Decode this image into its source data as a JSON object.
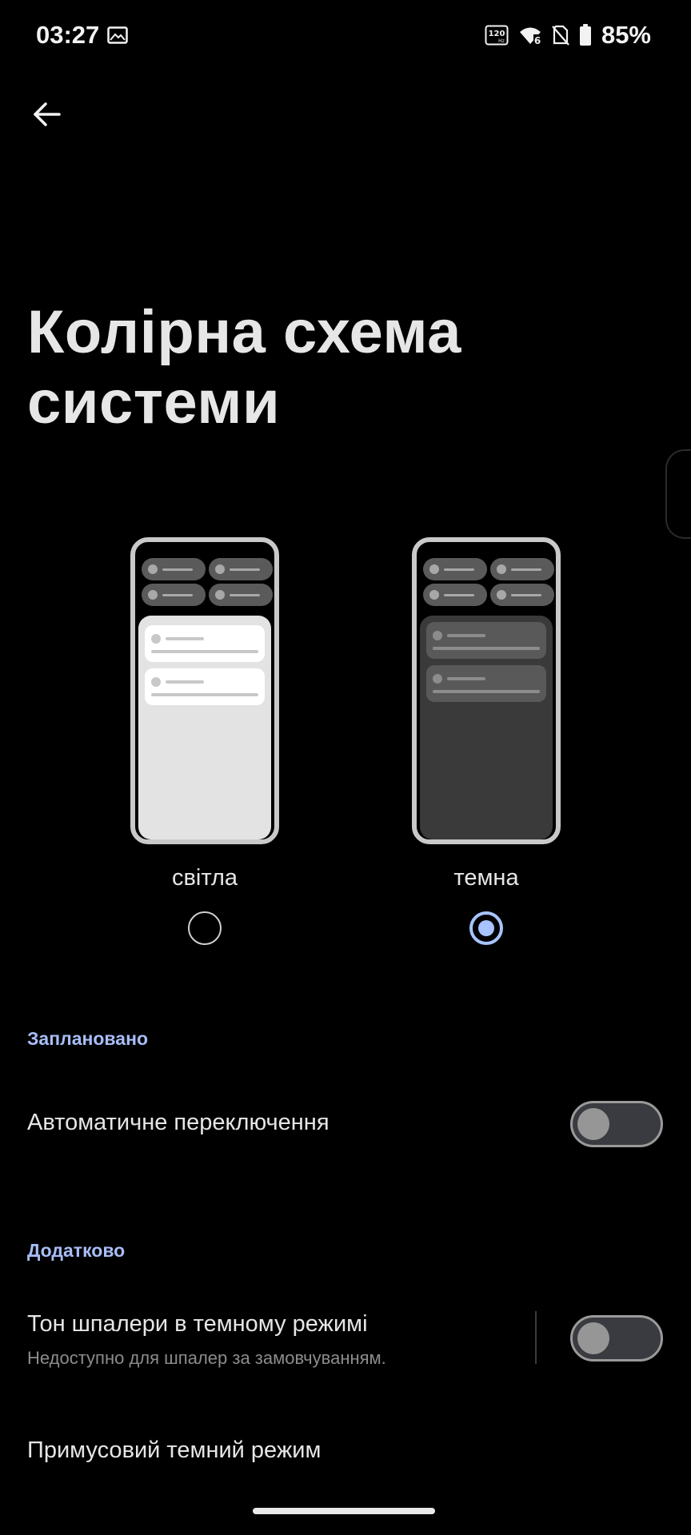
{
  "status_bar": {
    "time": "03:27",
    "gallery_icon": "image-icon",
    "refresh_icon": "120hz-icon",
    "wifi_icon": "wifi-6-icon",
    "sim_icon": "no-sim-icon",
    "battery_icon": "battery-icon",
    "battery_percent": "85%"
  },
  "header": {
    "back_icon": "back-arrow-icon",
    "title": "Колірна схема системи"
  },
  "theme_options": [
    {
      "label": "світла",
      "selected": false
    },
    {
      "label": "темна",
      "selected": true
    }
  ],
  "sections": {
    "scheduled": {
      "header": "Заплановано",
      "auto_switch": {
        "title": "Автоматичне переключення",
        "enabled": false
      }
    },
    "additional": {
      "header": "Додатково",
      "wallpaper_tone": {
        "title": "Тон шпалери в темному режимі",
        "subtitle": "Недоступно для шпалер за замовчуванням.",
        "enabled": false
      },
      "force_dark": {
        "title": "Примусовий темний режим"
      }
    }
  },
  "colors": {
    "accent": "#a8bdf6",
    "radio_selected": "#a8c3ff",
    "background": "#000000"
  }
}
